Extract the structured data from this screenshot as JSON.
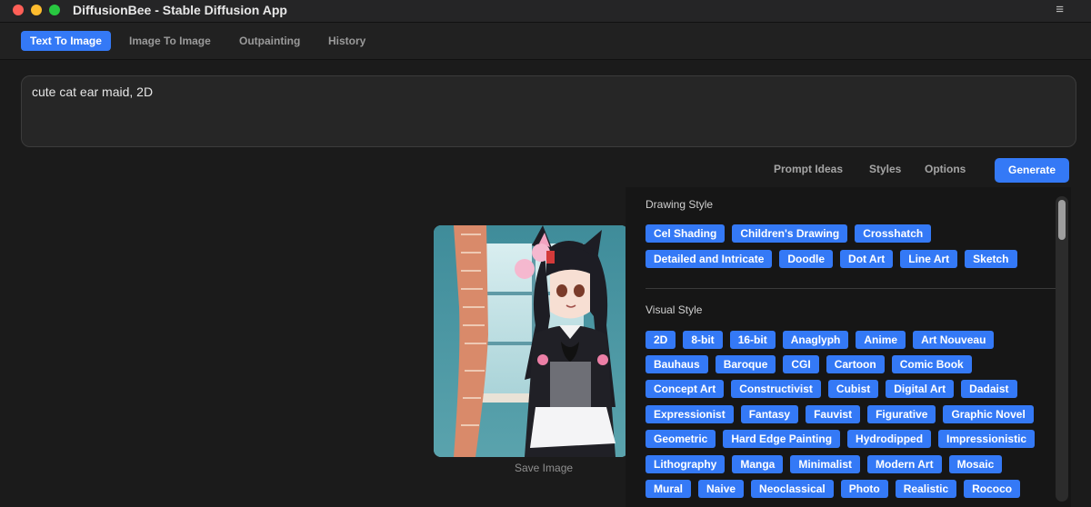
{
  "window": {
    "title": "DiffusionBee - Stable Diffusion App"
  },
  "tabs": [
    {
      "label": "Text To Image",
      "active": true
    },
    {
      "label": "Image To Image",
      "active": false
    },
    {
      "label": "Outpainting",
      "active": false
    },
    {
      "label": "History",
      "active": false
    }
  ],
  "prompt": {
    "value": "cute cat ear maid, 2D"
  },
  "toolbar": {
    "prompt_ideas": "Prompt Ideas",
    "styles": "Styles",
    "options": "Options",
    "generate": "Generate"
  },
  "result": {
    "save_label": "Save Image"
  },
  "styles_panel": {
    "drawing_style": {
      "title": "Drawing Style",
      "rows": [
        [
          "Cel Shading",
          "Children's Drawing",
          "Crosshatch"
        ],
        [
          "Detailed and Intricate",
          "Doodle",
          "Dot Art",
          "Line Art",
          "Sketch"
        ]
      ]
    },
    "visual_style": {
      "title": "Visual Style",
      "rows": [
        [
          "2D",
          "8-bit",
          "16-bit",
          "Anaglyph",
          "Anime",
          "Art Nouveau"
        ],
        [
          "Bauhaus",
          "Baroque",
          "CGI",
          "Cartoon",
          "Comic Book"
        ],
        [
          "Concept Art",
          "Constructivist",
          "Cubist",
          "Digital Art",
          "Dadaist"
        ],
        [
          "Expressionist",
          "Fantasy",
          "Fauvist",
          "Figurative",
          "Graphic Novel"
        ],
        [
          "Geometric",
          "Hard Edge Painting",
          "Hydrodipped",
          "Impressionistic"
        ],
        [
          "Lithography",
          "Manga",
          "Minimalist",
          "Modern Art",
          "Mosaic"
        ],
        [
          "Mural",
          "Naive",
          "Neoclassical",
          "Photo",
          "Realistic",
          "Rococo"
        ]
      ]
    }
  },
  "colors": {
    "accent": "#3479f6",
    "background": "#1b1b1b",
    "panel": "#161616"
  }
}
